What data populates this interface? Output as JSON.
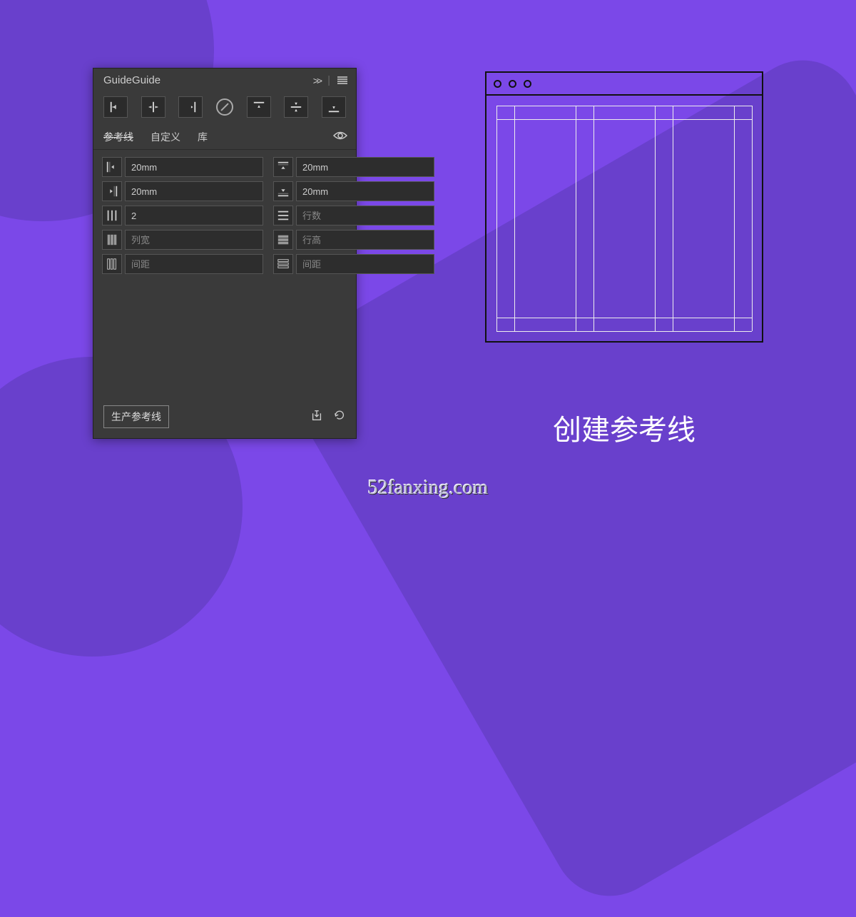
{
  "panel": {
    "title": "GuideGuide",
    "collapse": ">>"
  },
  "tabs": {
    "guides": "参考线",
    "custom": "自定义",
    "library": "库"
  },
  "fields": {
    "margin_left": "20mm",
    "margin_right": "20mm",
    "margin_top": "20mm",
    "margin_bottom": "20mm",
    "columns": "2",
    "rows_ph": "行数",
    "col_width_ph": "列宽",
    "row_height_ph": "行高",
    "gutter_col_ph": "间距",
    "gutter_row_ph": "间距"
  },
  "footer": {
    "generate": "生产参考线"
  },
  "caption": "创建参考线",
  "watermark": "52fanxing.com",
  "colors": {
    "bg": "#7b48e8",
    "bg_dark": "#6940cc",
    "panel": "#3a3a3a"
  }
}
